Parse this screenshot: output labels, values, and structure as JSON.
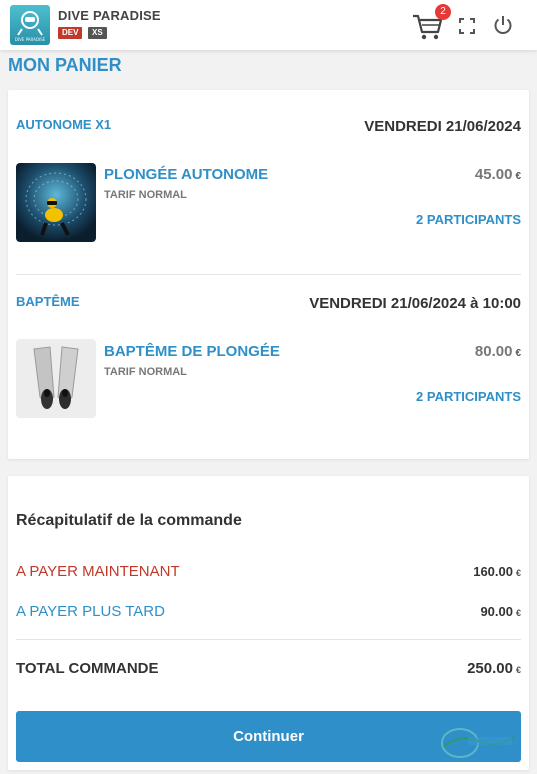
{
  "header": {
    "app_name": "DIVE PARADISE",
    "logo_text": "DIVE PARADISE",
    "env_tag": "DEV",
    "size_tag": "XS",
    "cart_count": "2"
  },
  "page": {
    "title": "MON PANIER"
  },
  "cart": {
    "sections": [
      {
        "title": "AUTONOME X1",
        "date": "VENDREDI 21/06/2024",
        "item": {
          "name": "PLONGÉE AUTONOME",
          "tarif": "TARIF NORMAL",
          "price": "45.00",
          "currency": "€",
          "participants": "2 PARTICIPANTS",
          "image_icon": "diver-photo-icon"
        }
      },
      {
        "title": "BAPTÊME",
        "date": "VENDREDI 21/06/2024 à 10:00",
        "item": {
          "name": "BAPTÊME DE PLONGÉE",
          "tarif": "TARIF NORMAL",
          "price": "80.00",
          "currency": "€",
          "participants": "2 PARTICIPANTS",
          "image_icon": "fins-photo-icon"
        }
      }
    ]
  },
  "summary": {
    "title": "Récapitulatif de la commande",
    "pay_now_label": "A PAYER MAINTENANT",
    "pay_now_value": "160.00",
    "pay_later_label": "A PAYER PLUS TARD",
    "pay_later_value": "90.00",
    "total_label": "TOTAL COMMANDE",
    "total_value": "250.00",
    "currency": "€",
    "continue_label": "Continuer"
  },
  "colors": {
    "primary": "#2f8fc8",
    "danger": "#c0392b",
    "badge": "#e53935"
  }
}
